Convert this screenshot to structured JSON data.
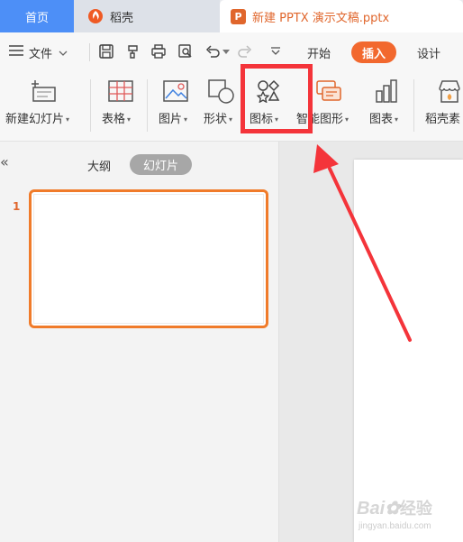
{
  "tabs": {
    "home": "首页",
    "daoke": "稻壳",
    "doc": "新建 PPTX 演示文稿.pptx"
  },
  "menu": {
    "file": "文件",
    "start": "开始",
    "insert": "插入",
    "design": "设计"
  },
  "ribbon": {
    "new_slide": "新建幻灯片",
    "table": "表格",
    "picture": "图片",
    "shape": "形状",
    "icon": "图标",
    "smart_art": "智能图形",
    "chart": "图表",
    "daoke_material": "稻壳素"
  },
  "panel": {
    "outline": "大纲",
    "slides": "幻灯片",
    "collapse": "«",
    "slide_number": "1"
  },
  "watermark": {
    "brand": "Bai",
    "brand_tail": "经验",
    "url": "jingyan.baidu.com"
  },
  "colors": {
    "accent": "#f2682e",
    "home_tab": "#4d8ff7",
    "highlight": "#f4343a",
    "slide_border": "#f07b2a"
  }
}
